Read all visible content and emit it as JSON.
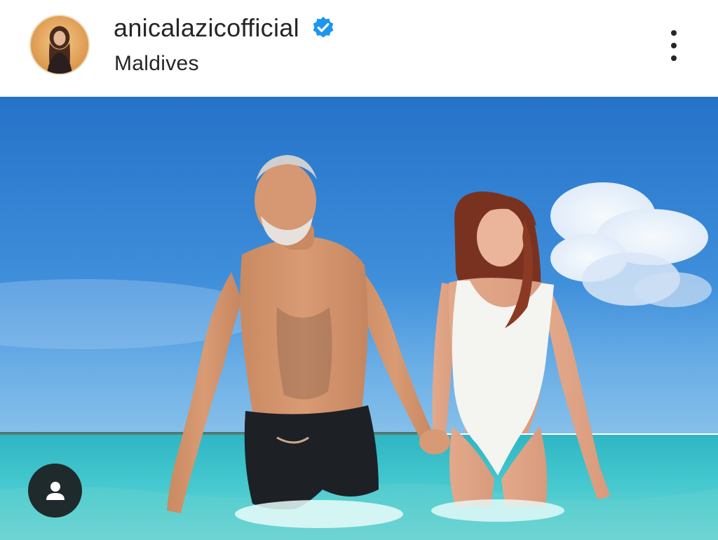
{
  "post": {
    "username": "anicalazicofficial",
    "location": "Maldives",
    "verified": true,
    "icons": {
      "avatar": "profile-photo",
      "verified": "verified-badge-icon",
      "more": "more-options-icon",
      "tags": "user-tags-icon"
    }
  },
  "colors": {
    "text": "#262626",
    "verified_blue": "#1c96f0",
    "sky_top": "#2a78cf",
    "sea": "#3fc4c9",
    "tags_button": "#1f2a2c"
  }
}
